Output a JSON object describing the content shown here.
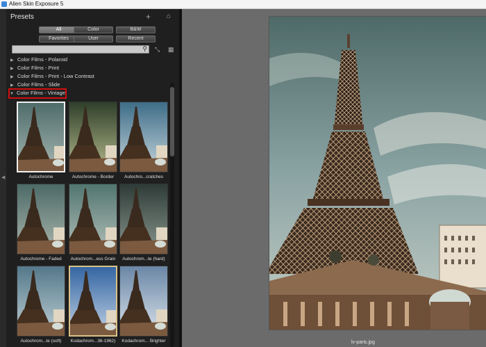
{
  "window": {
    "title": "Alien Skin Exposure 5"
  },
  "presets_panel": {
    "title": "Presets",
    "icons": {
      "add": "plus-icon",
      "home": "home-icon"
    },
    "filters_row1": [
      "All",
      "Color",
      "B&W"
    ],
    "filters_row2": [
      "Favorites",
      "User",
      "Recent"
    ],
    "active_filter": "All",
    "search": {
      "value": "",
      "placeholder": ""
    },
    "categories": [
      {
        "label": "Color Films - Polaroid",
        "expanded": false
      },
      {
        "label": "Color Films - Print",
        "expanded": false
      },
      {
        "label": "Color Films - Print - Low Contrast",
        "expanded": false
      },
      {
        "label": "Color Films - Slide",
        "expanded": false
      },
      {
        "label": "Color Films - Vintage",
        "expanded": true,
        "highlighted": true
      }
    ],
    "thumbnails": [
      {
        "label": "Autochrome",
        "selected": true
      },
      {
        "label": "Autochrome - Border"
      },
      {
        "label": "Autochro...cratches"
      },
      {
        "label": "Autochrome - Faded"
      },
      {
        "label": "Autochrom...ess Grain"
      },
      {
        "label": "Autochrom...te (hard)"
      },
      {
        "label": "Autochrom...te (soft)"
      },
      {
        "label": "Kodachrom...36-1962)"
      },
      {
        "label": "Kodachrom... Brighter"
      }
    ]
  },
  "canvas": {
    "filename": "lv-paris.jpg"
  }
}
